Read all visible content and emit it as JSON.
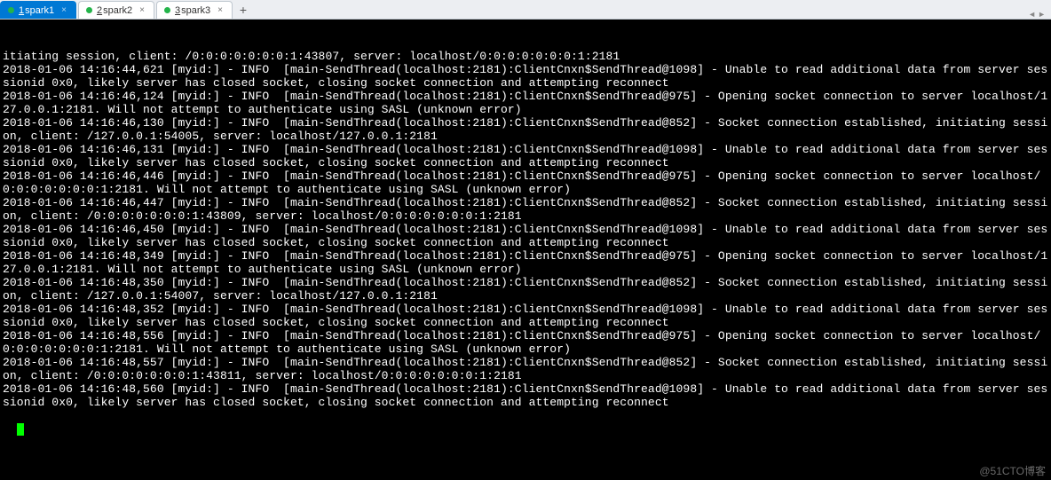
{
  "tabs": [
    {
      "key": "1",
      "label": "spark1",
      "dot": "#24b44a",
      "active": true
    },
    {
      "key": "2",
      "label": "spark2",
      "dot": "#24b44a",
      "active": false
    },
    {
      "key": "3",
      "label": "spark3",
      "dot": "#24b44a",
      "active": false
    }
  ],
  "add_tab_label": "+",
  "nav_left": "◄",
  "nav_right": "►",
  "close_glyph": "×",
  "log_lines": [
    "itiating session, client: /0:0:0:0:0:0:0:1:43807, server: localhost/0:0:0:0:0:0:0:1:2181",
    "2018-01-06 14:16:44,621 [myid:] - INFO  [main-SendThread(localhost:2181):ClientCnxn$SendThread@1098] - Unable to read additional data from server sessionid 0x0, likely server has closed socket, closing socket connection and attempting reconnect",
    "2018-01-06 14:16:46,124 [myid:] - INFO  [main-SendThread(localhost:2181):ClientCnxn$SendThread@975] - Opening socket connection to server localhost/127.0.0.1:2181. Will not attempt to authenticate using SASL (unknown error)",
    "2018-01-06 14:16:46,130 [myid:] - INFO  [main-SendThread(localhost:2181):ClientCnxn$SendThread@852] - Socket connection established, initiating session, client: /127.0.0.1:54005, server: localhost/127.0.0.1:2181",
    "2018-01-06 14:16:46,131 [myid:] - INFO  [main-SendThread(localhost:2181):ClientCnxn$SendThread@1098] - Unable to read additional data from server sessionid 0x0, likely server has closed socket, closing socket connection and attempting reconnect",
    "2018-01-06 14:16:46,446 [myid:] - INFO  [main-SendThread(localhost:2181):ClientCnxn$SendThread@975] - Opening socket connection to server localhost/0:0:0:0:0:0:0:1:2181. Will not attempt to authenticate using SASL (unknown error)",
    "2018-01-06 14:16:46,447 [myid:] - INFO  [main-SendThread(localhost:2181):ClientCnxn$SendThread@852] - Socket connection established, initiating session, client: /0:0:0:0:0:0:0:1:43809, server: localhost/0:0:0:0:0:0:0:1:2181",
    "2018-01-06 14:16:46,450 [myid:] - INFO  [main-SendThread(localhost:2181):ClientCnxn$SendThread@1098] - Unable to read additional data from server sessionid 0x0, likely server has closed socket, closing socket connection and attempting reconnect",
    "2018-01-06 14:16:48,349 [myid:] - INFO  [main-SendThread(localhost:2181):ClientCnxn$SendThread@975] - Opening socket connection to server localhost/127.0.0.1:2181. Will not attempt to authenticate using SASL (unknown error)",
    "2018-01-06 14:16:48,350 [myid:] - INFO  [main-SendThread(localhost:2181):ClientCnxn$SendThread@852] - Socket connection established, initiating session, client: /127.0.0.1:54007, server: localhost/127.0.0.1:2181",
    "2018-01-06 14:16:48,352 [myid:] - INFO  [main-SendThread(localhost:2181):ClientCnxn$SendThread@1098] - Unable to read additional data from server sessionid 0x0, likely server has closed socket, closing socket connection and attempting reconnect",
    "2018-01-06 14:16:48,556 [myid:] - INFO  [main-SendThread(localhost:2181):ClientCnxn$SendThread@975] - Opening socket connection to server localhost/0:0:0:0:0:0:0:1:2181. Will not attempt to authenticate using SASL (unknown error)",
    "2018-01-06 14:16:48,557 [myid:] - INFO  [main-SendThread(localhost:2181):ClientCnxn$SendThread@852] - Socket connection established, initiating session, client: /0:0:0:0:0:0:0:1:43811, server: localhost/0:0:0:0:0:0:0:1:2181",
    "2018-01-06 14:16:48,560 [myid:] - INFO  [main-SendThread(localhost:2181):ClientCnxn$SendThread@1098] - Unable to read additional data from server sessionid 0x0, likely server has closed socket, closing socket connection and attempting reconnect"
  ],
  "watermark": "@51CTO博客"
}
